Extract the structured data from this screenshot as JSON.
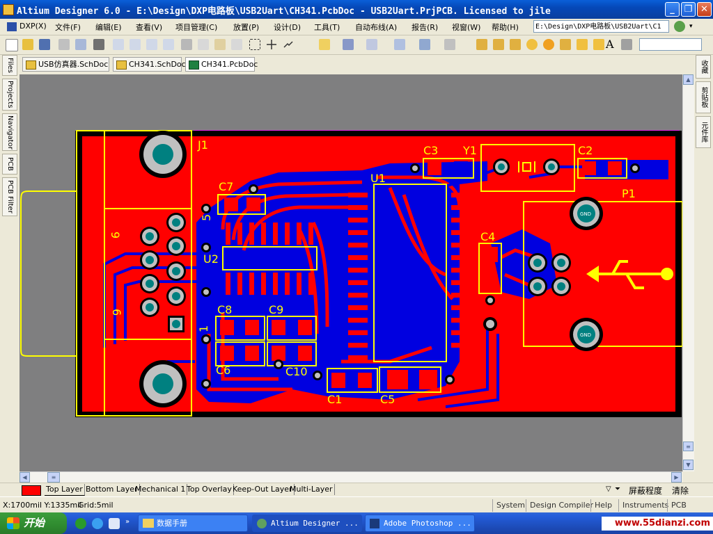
{
  "window": {
    "title": "Altium Designer 6.0 - E:\\Design\\DXP电路板\\USB2Uart\\CH341.PcbDoc - USB2Uart.PrjPCB. Licensed to jile",
    "minimize": "_",
    "maximize": "❐",
    "close": "✕"
  },
  "menu": {
    "items": [
      "DXP(X)",
      "文件(F)",
      "编辑(E)",
      "查看(V)",
      "项目管理(C)",
      "放置(P)",
      "设计(D)",
      "工具(T)",
      "自动布线(A)",
      "报告(R)",
      "视窗(W)",
      "帮助(H)"
    ],
    "path": "E:\\Design\\DXP电路板\\USB2Uart\\C1"
  },
  "doc_tabs": [
    {
      "label": "USB仿真器.SchDoc",
      "kind": "sch"
    },
    {
      "label": "CH341.SchDoc",
      "kind": "sch"
    },
    {
      "label": "CH341.PcbDoc",
      "kind": "pcb"
    }
  ],
  "left_panels": [
    "Files",
    "Projects",
    "Navigator",
    "PCB",
    "PCB Filter"
  ],
  "right_panels": [
    "收藏",
    "剪贴板",
    "元件库"
  ],
  "pcb": {
    "designators": {
      "J1": "J1",
      "C7": "C7",
      "U2": "U2",
      "C8": "C8",
      "C9": "C9",
      "C6": "C6",
      "C10": "C10",
      "U1": "U1",
      "C3": "C3",
      "Y1": "Y1",
      "C2": "C2",
      "P1": "P1",
      "C4": "C4",
      "C1": "C1",
      "C5": "C5"
    },
    "pin_marks": {
      "five": "5",
      "nine": "9",
      "six": "6",
      "one": "1"
    },
    "gnd": "GND",
    "colors": {
      "top_layer": "#ff0000",
      "bottom_layer": "#0000ff",
      "overlay": "#ffff00",
      "keepout": "#ff00ff",
      "pad": "#c0c0c0",
      "via": "#008080"
    }
  },
  "layers": {
    "swatch_color": "#ff0000",
    "tabs": [
      "Top Layer",
      "Bottom Layer",
      "Mechanical 1",
      "Top Overlay",
      "Keep-Out Layer",
      "Multi-Layer"
    ],
    "mask_level": "屏蔽程度",
    "clear": "清除"
  },
  "status": {
    "coords": "X:1700mil Y:1335mil",
    "grid": "Grid:5mil",
    "buttons": [
      "System",
      "Design Compiler",
      "Help",
      "Instruments",
      "PCB"
    ]
  },
  "taskbar": {
    "start": "开始",
    "items": [
      "数据手册",
      "Altium Designer ...",
      "Adobe Photoshop ..."
    ],
    "watermark": "www.55dianzi.com"
  }
}
